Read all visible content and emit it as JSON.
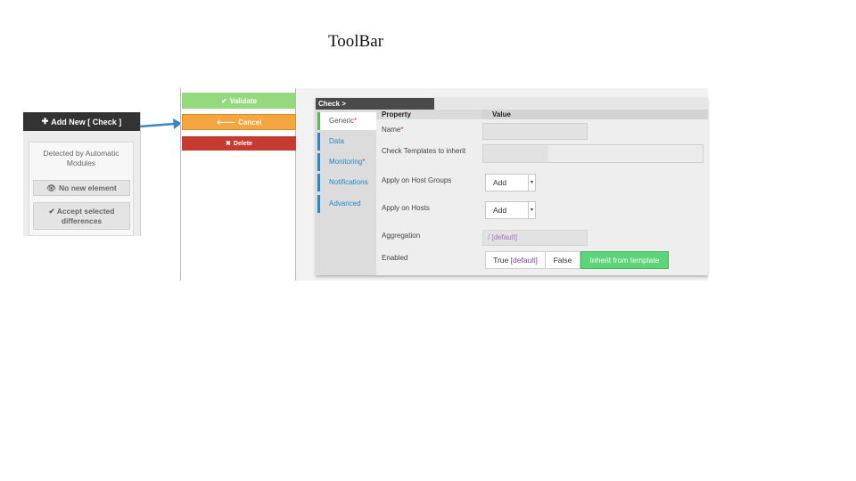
{
  "slide": {
    "title": "ToolBar"
  },
  "left_toolbar": {
    "add_new": "Add New [ Check ]",
    "detected": "Detected by Automatic Modules",
    "no_new": "No new element",
    "accept": "Accept selected differences"
  },
  "actions": {
    "validate": "Validate",
    "cancel": "Cancel",
    "delete": "Delete"
  },
  "form": {
    "header": "Check >",
    "tabs": [
      {
        "label": "Generic",
        "required": true
      },
      {
        "label": "Data",
        "required": false
      },
      {
        "label": "Monitoring",
        "required": true
      },
      {
        "label": "Notifications",
        "required": false
      },
      {
        "label": "Advanced",
        "required": false
      }
    ],
    "columns": {
      "property": "Property",
      "value": "Value"
    },
    "fields": {
      "name": "Name",
      "templates": "Check Templates to inherit",
      "host_groups": "Apply on Host Groups",
      "hosts": "Apply on Hosts",
      "aggregation": "Aggregation",
      "enabled": "Enabled"
    },
    "host_groups_select": "Add",
    "hosts_select": "Add",
    "aggregation_value": "/ [default]",
    "enabled_options": {
      "true_label": "True",
      "true_default": "[default]",
      "false_label": "False",
      "inherit_label": "Inherit from template"
    }
  },
  "colors": {
    "validate": "#94d97d",
    "cancel": "#f5a640",
    "delete": "#c63a30",
    "tab_accent": "#2a86c7",
    "inherit_active": "#5cd47a"
  },
  "icons": {
    "add": "plus-icon",
    "eye": "eye-icon",
    "check": "check-icon",
    "back": "arrow-left-icon",
    "delete": "x-icon"
  }
}
